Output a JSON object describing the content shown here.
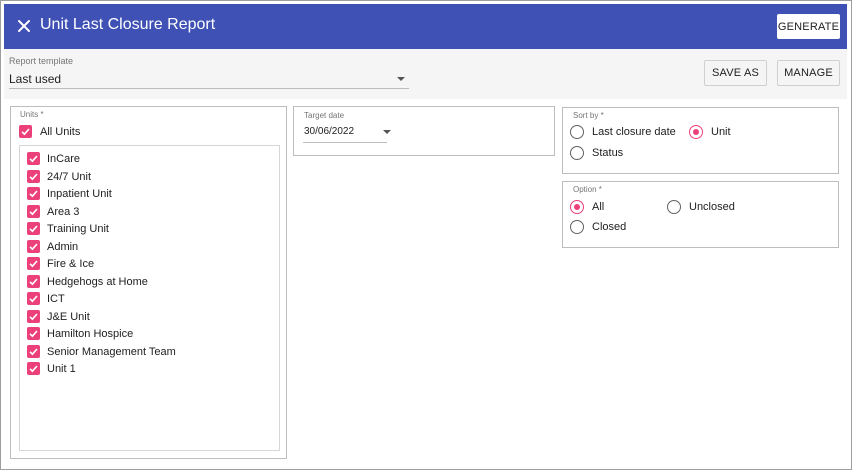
{
  "header": {
    "title": "Unit Last Closure Report",
    "generate_label": "GENERATE",
    "color": "#3f51b5"
  },
  "toolbar": {
    "template_label": "Report template",
    "template_value": "Last used",
    "save_as_label": "SAVE AS",
    "manage_label": "MANAGE"
  },
  "units": {
    "legend": "Units *",
    "all_label": "All Units",
    "all_checked": true,
    "items": [
      {
        "label": "InCare",
        "checked": true
      },
      {
        "label": "24/7 Unit",
        "checked": true
      },
      {
        "label": "Inpatient Unit",
        "checked": true
      },
      {
        "label": "Area 3",
        "checked": true
      },
      {
        "label": "Training Unit",
        "checked": true
      },
      {
        "label": "Admin",
        "checked": true
      },
      {
        "label": "Fire & Ice",
        "checked": true
      },
      {
        "label": "Hedgehogs at Home",
        "checked": true
      },
      {
        "label": "ICT",
        "checked": true
      },
      {
        "label": "J&E Unit",
        "checked": true
      },
      {
        "label": "Hamilton Hospice",
        "checked": true
      },
      {
        "label": "Senior Management Team",
        "checked": true
      },
      {
        "label": "Unit 1",
        "checked": true
      }
    ]
  },
  "target_date": {
    "label": "Target date",
    "value": "30/06/2022"
  },
  "sort_by": {
    "legend": "Sort by *",
    "options": [
      {
        "label": "Last closure date",
        "selected": false
      },
      {
        "label": "Unit",
        "selected": true
      },
      {
        "label": "Status",
        "selected": false
      }
    ]
  },
  "option": {
    "legend": "Option *",
    "options": [
      {
        "label": "All",
        "selected": true
      },
      {
        "label": "Unclosed",
        "selected": false
      },
      {
        "label": "Closed",
        "selected": false
      }
    ]
  },
  "colors": {
    "accent": "#ec407a",
    "header": "#3f51b5"
  },
  "icons": {
    "close": "close-icon",
    "check": "check-icon",
    "dropdown": "chevron-down-icon"
  }
}
